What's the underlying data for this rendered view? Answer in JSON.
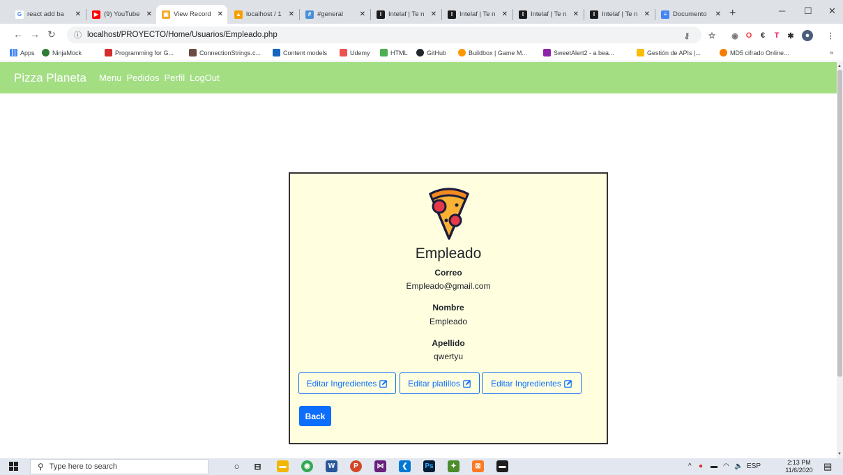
{
  "browser": {
    "tabs": [
      {
        "title": "react add ba",
        "favicon": "google-icon",
        "color": "#4285f4",
        "active": false
      },
      {
        "title": "(9) YouTube",
        "favicon": "youtube-icon",
        "color": "#ff0000",
        "active": false
      },
      {
        "title": "View Record",
        "favicon": "record-icon",
        "color": "#f5a623",
        "active": true
      },
      {
        "title": "localhost / 1",
        "favicon": "phpmyadmin-icon",
        "color": "#f4a000",
        "active": false
      },
      {
        "title": "#general",
        "favicon": "slack-icon",
        "color": "#4a90d9",
        "active": false
      },
      {
        "title": "Intelaf | Te n",
        "favicon": "intelaf-icon",
        "color": "#1b1b1b",
        "active": false
      },
      {
        "title": "Intelaf | Te n",
        "favicon": "intelaf-icon",
        "color": "#1b1b1b",
        "active": false
      },
      {
        "title": "Intelaf | Te n",
        "favicon": "intelaf-icon",
        "color": "#1b1b1b",
        "active": false
      },
      {
        "title": "Intelaf | Te n",
        "favicon": "intelaf-icon",
        "color": "#1b1b1b",
        "active": false
      },
      {
        "title": "Documento",
        "favicon": "google-docs-icon",
        "color": "#4285f4",
        "active": false
      }
    ],
    "new_tab": "+",
    "minimize": "─",
    "maximize": "☐",
    "close": "✕",
    "url": "localhost/PROYECTO/Home/Usuarios/Empleado.php",
    "bookmarks": [
      {
        "label": "Apps",
        "icon": "apps-grid-icon",
        "color": "#4285f4"
      },
      {
        "label": "NinjaMock",
        "icon": "ninjamock-icon",
        "color": "#2e7d32"
      },
      {
        "label": "Programming for G...",
        "icon": "programming-icon",
        "color": "#d32f2f"
      },
      {
        "label": "ConnectionStrings.c...",
        "icon": "connectionstrings-icon",
        "color": "#6d4c41"
      },
      {
        "label": "Content models",
        "icon": "ws-icon",
        "color": "#1565c0"
      },
      {
        "label": "Udemy",
        "icon": "udemy-icon",
        "color": "#ec5252"
      },
      {
        "label": "HTML",
        "icon": "html-icon",
        "color": "#4caf50"
      },
      {
        "label": "GitHub",
        "icon": "github-icon",
        "color": "#24292e"
      },
      {
        "label": "Buildbox | Game M...",
        "icon": "buildbox-icon",
        "color": "#ff9800"
      },
      {
        "label": "SweetAlert2 - a bea...",
        "icon": "sweetalert-icon",
        "color": "#8e24aa"
      },
      {
        "label": "Gestión de APIs |...",
        "icon": "google-drive-icon",
        "color": "#fbbc05"
      },
      {
        "label": "MD5 cifrado Online...",
        "icon": "md5-icon",
        "color": "#f57c00"
      }
    ],
    "more_bookmarks": "»"
  },
  "site": {
    "brand": "Pizza Planeta",
    "nav": [
      "Menu",
      "Pedidos",
      "Perfil",
      "LogOut"
    ],
    "nav_color": "#a3de83"
  },
  "card": {
    "icon": "pizza-slice-icon",
    "title": "Empleado",
    "fields": [
      {
        "label": "Correo",
        "value": "Empleado@gmail.com"
      },
      {
        "label": "Nombre",
        "value": "Empleado"
      },
      {
        "label": "Apellido",
        "value": "qwertyu"
      }
    ],
    "buttons": [
      "Editar Ingredientes",
      "Editar platillos",
      "Editar Ingredientes"
    ],
    "back": "Back",
    "accent": "#0d6efd",
    "background": "#ffffe0"
  },
  "taskbar": {
    "search_placeholder": "Type here to search",
    "apps": [
      {
        "icon": "cortana-icon",
        "color": "#ffffff"
      },
      {
        "icon": "task-view-icon",
        "color": "#ffffff"
      },
      {
        "icon": "file-explorer-icon",
        "color": "#f2b705"
      },
      {
        "icon": "chrome-icon",
        "color": "#34a853"
      },
      {
        "icon": "word-icon",
        "color": "#2b579a"
      },
      {
        "icon": "powerpoint-icon",
        "color": "#d24726"
      },
      {
        "icon": "visual-studio-icon",
        "color": "#68217a"
      },
      {
        "icon": "vscode-icon",
        "color": "#0078d4"
      },
      {
        "icon": "photoshop-icon",
        "color": "#001e36"
      },
      {
        "icon": "unity-icon",
        "color": "#4c8c2b"
      },
      {
        "icon": "xampp-icon",
        "color": "#fb7a24"
      },
      {
        "icon": "terminal-icon",
        "color": "#1e1e1e"
      }
    ],
    "language": "ESP",
    "time": "2:13 PM",
    "date": "11/6/2020"
  }
}
